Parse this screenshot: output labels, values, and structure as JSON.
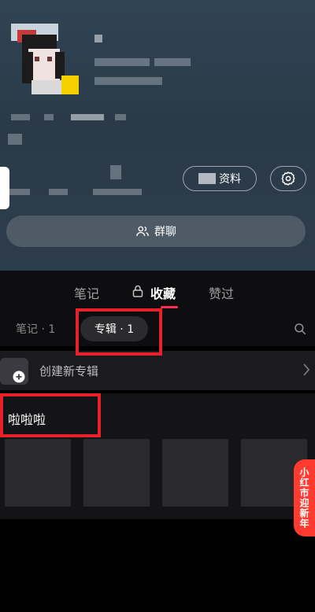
{
  "profile": {
    "edit_profile_label": "资料",
    "settings_icon": "gear-icon",
    "group_chat_label": "群聊",
    "group_chat_icon": "users-icon"
  },
  "tabs": [
    {
      "label": "笔记",
      "active": false
    },
    {
      "label": "收藏",
      "active": true,
      "icon": "lock-icon"
    },
    {
      "label": "赞过",
      "active": false
    }
  ],
  "sub_tabs": [
    {
      "label": "笔记 · 1",
      "active": false
    },
    {
      "label": "专辑 · 1",
      "active": true
    }
  ],
  "sub_tabs_search_icon": "search-icon",
  "create_album": {
    "label": "创建新专辑",
    "icon": "plus-icon",
    "arrow": "chevron-right-icon"
  },
  "album": {
    "title": "啦啦啦",
    "thumbnail_count": 4
  },
  "promo_badge": {
    "text": "小红市迎新年"
  },
  "colors": {
    "accent": "#fe2c55",
    "highlight": "#e8202a",
    "promo": "#ff3b30"
  }
}
